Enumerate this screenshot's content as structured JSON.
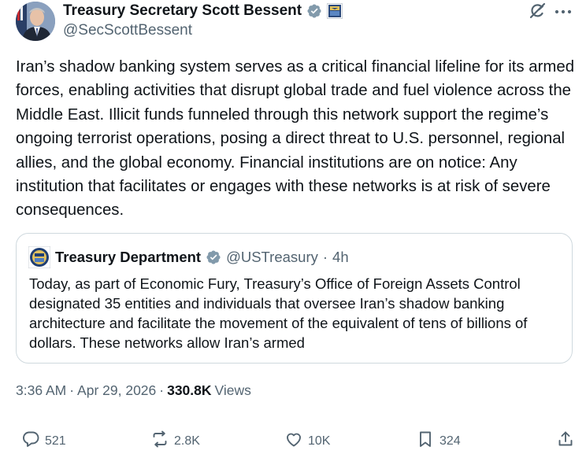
{
  "author": {
    "name": "Treasury Secretary Scott Bessent",
    "handle": "@SecScottBessent"
  },
  "tweet": {
    "text": "Iran’s shadow banking system serves as a critical financial lifeline for its armed forces, enabling activities that disrupt global trade and fuel violence across the Middle East. Illicit funds funneled through this network support the regime’s ongoing terrorist operations, posing a direct threat to U.S. personnel, regional allies, and the global economy. Financial institutions are on notice: Any institution that facilitates or engages with these networks is at risk of severe consequences."
  },
  "quote": {
    "name": "Treasury Department",
    "handle": "@USTreasury",
    "separator": "·",
    "time": "4h",
    "text": "Today, as part of Economic Fury, Treasury’s Office of Foreign Assets Control designated 35 entities and individuals that oversee Iran’s shadow banking architecture and facilitate the movement of the equivalent of tens of billions of dollars. These networks allow Iran’s armed"
  },
  "meta": {
    "time": "3:36 AM",
    "separator": "·",
    "date": "Apr 29, 2026",
    "views_count": "330.8K",
    "views_label": "Views"
  },
  "actions": {
    "replies": "521",
    "reposts": "2.8K",
    "likes": "10K",
    "bookmarks": "324"
  },
  "colors": {
    "verified": "#1d9bf0",
    "secondary_text": "#536471",
    "border": "#cfd9de"
  },
  "icons": {
    "verified": "verified-badge-icon",
    "affiliation": "treasury-seal-icon",
    "grok": "grok-icon",
    "more": "more-icon",
    "reply": "reply-icon",
    "repost": "repost-icon",
    "like": "heart-icon",
    "bookmark": "bookmark-icon",
    "share": "share-icon"
  }
}
